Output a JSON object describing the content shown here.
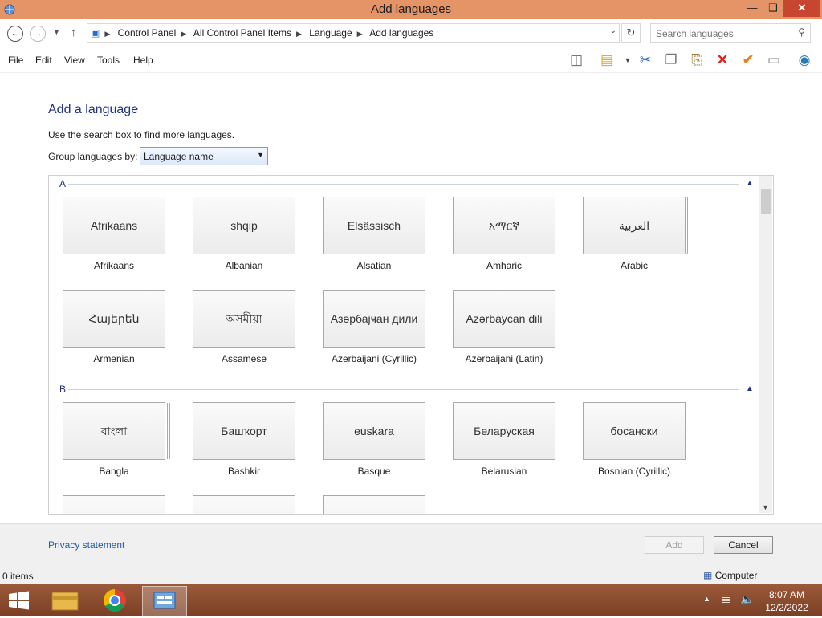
{
  "window": {
    "title": "Add languages"
  },
  "address": {
    "crumbs": [
      "Control Panel",
      "All Control Panel Items",
      "Language",
      "Add languages"
    ]
  },
  "search": {
    "placeholder": "Search languages"
  },
  "menu": {
    "items": [
      "File",
      "Edit",
      "View",
      "Tools",
      "Help"
    ]
  },
  "main": {
    "heading": "Add a language",
    "instruction": "Use the search box to find more languages.",
    "group_label": "Group languages by:",
    "group_value": "Language name"
  },
  "groups": {
    "a": {
      "letter": "A"
    },
    "b": {
      "letter": "B"
    }
  },
  "tiles": [
    {
      "native": "Afrikaans",
      "name": "Afrikaans"
    },
    {
      "native": "shqip",
      "name": "Albanian"
    },
    {
      "native": "Elsässisch",
      "name": "Alsatian"
    },
    {
      "native": "አማርኛ",
      "name": "Amharic"
    },
    {
      "native": "العربية",
      "name": "Arabic"
    },
    {
      "native": "Հայերեն",
      "name": "Armenian"
    },
    {
      "native": "অসমীয়া",
      "name": "Assamese"
    },
    {
      "native": "Азәрбајҹан дили",
      "name": "Azerbaijani (Cyrillic)"
    },
    {
      "native": "Azərbaycan dili",
      "name": "Azerbaijani (Latin)"
    },
    {
      "native": "বাংলা",
      "name": "Bangla"
    },
    {
      "native": "Башҡорт",
      "name": "Bashkir"
    },
    {
      "native": "euskara",
      "name": "Basque"
    },
    {
      "native": "Беларуская",
      "name": "Belarusian"
    },
    {
      "native": "босански",
      "name": "Bosnian (Cyrillic)"
    }
  ],
  "footer": {
    "privacy": "Privacy statement",
    "add": "Add",
    "cancel": "Cancel"
  },
  "status": {
    "items": "0 items",
    "zone": "Computer"
  },
  "taskbar": {
    "time": "8:07 AM",
    "date": "12/2/2022"
  },
  "colors": {
    "titlebar": "#e49467",
    "close": "#c7462f",
    "link": "#1e5aa8",
    "heading": "#1e3287",
    "taskbar": "#8b4a2e"
  }
}
